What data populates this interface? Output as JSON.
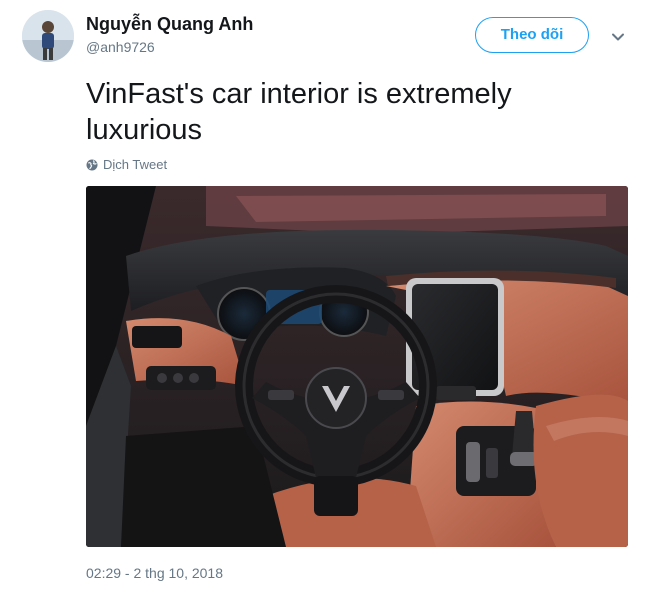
{
  "user": {
    "name": "Nguyễn Quang Anh",
    "handle": "@anh9726",
    "avatar_icon": "user-avatar"
  },
  "actions": {
    "follow_label": "Theo dõi",
    "menu_icon": "chevron-down-icon"
  },
  "tweet": {
    "text": "VinFast's car interior is extremely luxurious",
    "translate_label": "Dịch Tweet",
    "translate_icon": "globe-icon",
    "timestamp": "02:29 - 2 thg 10, 2018"
  },
  "colors": {
    "accent": "#1da1f2",
    "secondary_text": "#657786",
    "primary_text": "#14171a"
  }
}
